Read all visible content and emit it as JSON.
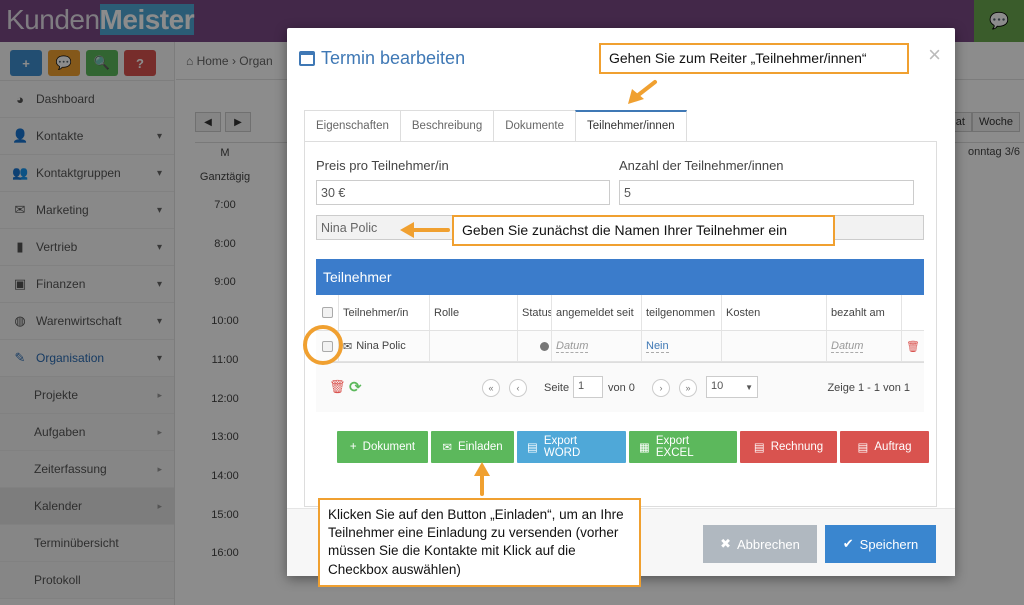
{
  "app": {
    "logo_light": "Kunden",
    "logo_bold": "Meister"
  },
  "quick_buttons": [
    {
      "symbol": "+",
      "color": "#3e8ed0"
    },
    {
      "symbol": "💬",
      "color": "#f0a030"
    },
    {
      "symbol": "🔍",
      "color": "#5cb85c"
    },
    {
      "symbol": "?",
      "color": "#d9534f"
    }
  ],
  "sidebar": {
    "items": [
      {
        "label": "Dashboard",
        "icon": "tachometer-icon",
        "glyph": "◕"
      },
      {
        "label": "Kontakte",
        "icon": "user-icon",
        "glyph": "👤"
      },
      {
        "label": "Kontaktgruppen",
        "icon": "users-icon",
        "glyph": "👥"
      },
      {
        "label": "Marketing",
        "icon": "envelope-icon",
        "glyph": "✉"
      },
      {
        "label": "Vertrieb",
        "icon": "bar-chart-icon",
        "glyph": "▮"
      },
      {
        "label": "Finanzen",
        "icon": "money-icon",
        "glyph": "▣"
      },
      {
        "label": "Warenwirtschaft",
        "icon": "globe-icon",
        "glyph": "◍"
      },
      {
        "label": "Organisation",
        "icon": "edit-icon",
        "glyph": "✎"
      }
    ],
    "subitems": [
      {
        "label": "Projekte"
      },
      {
        "label": "Aufgaben"
      },
      {
        "label": "Zeiterfassung"
      },
      {
        "label": "Kalender"
      },
      {
        "label": "Terminübersicht"
      },
      {
        "label": "Protokoll"
      }
    ]
  },
  "breadcrumb": {
    "home": "Home",
    "next": "Organ"
  },
  "calendar": {
    "allday": "Ganztägig",
    "hours": [
      "7:00",
      "8:00",
      "9:00",
      "10:00",
      "11:00",
      "12:00",
      "13:00",
      "14:00",
      "15:00",
      "16:00"
    ],
    "view_day_partial": "at",
    "view_week": "Woche",
    "head_right": "onntag 3/6",
    "head_mid": "M"
  },
  "modal": {
    "title": "Termin bearbeiten",
    "close": "×",
    "tabs": [
      "Eigenschaften",
      "Beschreibung",
      "Dokumente",
      "Teilnehmer/innen"
    ],
    "price_label": "Preis pro Teilnehmer/in",
    "price_value": "30 €",
    "count_label": "Anzahl der Teilnehmer/innen",
    "count_value": "5",
    "names_value": "Nina Polic",
    "panel_title": "Teilnehmer",
    "columns": [
      "Teilnehmer/in",
      "Rolle",
      "Status",
      "angemeldet seit",
      "teilgenommen",
      "Kosten",
      "bezahlt am"
    ],
    "row": {
      "name": "Nina Polic",
      "since": "Datum",
      "attended": "Nein",
      "paid": "Datum"
    },
    "pager": {
      "page_label": "Seite",
      "page": "1",
      "of": "von 0",
      "size": "10",
      "summary": "Zeige 1 - 1 von 1"
    },
    "actions": [
      {
        "label": "Dokument",
        "glyph": "+",
        "icon": "plus-icon",
        "cls": "g"
      },
      {
        "label": "Einladen",
        "glyph": "✉",
        "icon": "envelope-icon",
        "cls": "g"
      },
      {
        "label": "Export WORD",
        "glyph": "▤",
        "icon": "file-word-icon",
        "cls": "b"
      },
      {
        "label": "Export EXCEL",
        "glyph": "▦",
        "icon": "table-icon",
        "cls": "g"
      },
      {
        "label": "Rechnung",
        "glyph": "▤",
        "icon": "file-icon",
        "cls": "r"
      },
      {
        "label": "Auftrag",
        "glyph": "▤",
        "icon": "file-icon",
        "cls": "r"
      }
    ],
    "cancel": "Abbrechen",
    "save": "Speichern"
  },
  "callouts": {
    "tab_hint": "Gehen Sie zum Reiter „Teilnehmer/innen“",
    "names_hint": "Geben Sie zunächst die Namen Ihrer Teilnehmer ein",
    "invite_hint": "Klicken Sie auf den Button „Einladen“, um an Ihre Teilnehmer eine Einladung zu versenden (vorher müssen Sie die Kontakte mit Klick auf die Checkbox auswählen)"
  },
  "colors": {
    "accent": "#3f78b5",
    "callout_border": "#f0a030",
    "panel": "#3b7ccb"
  }
}
